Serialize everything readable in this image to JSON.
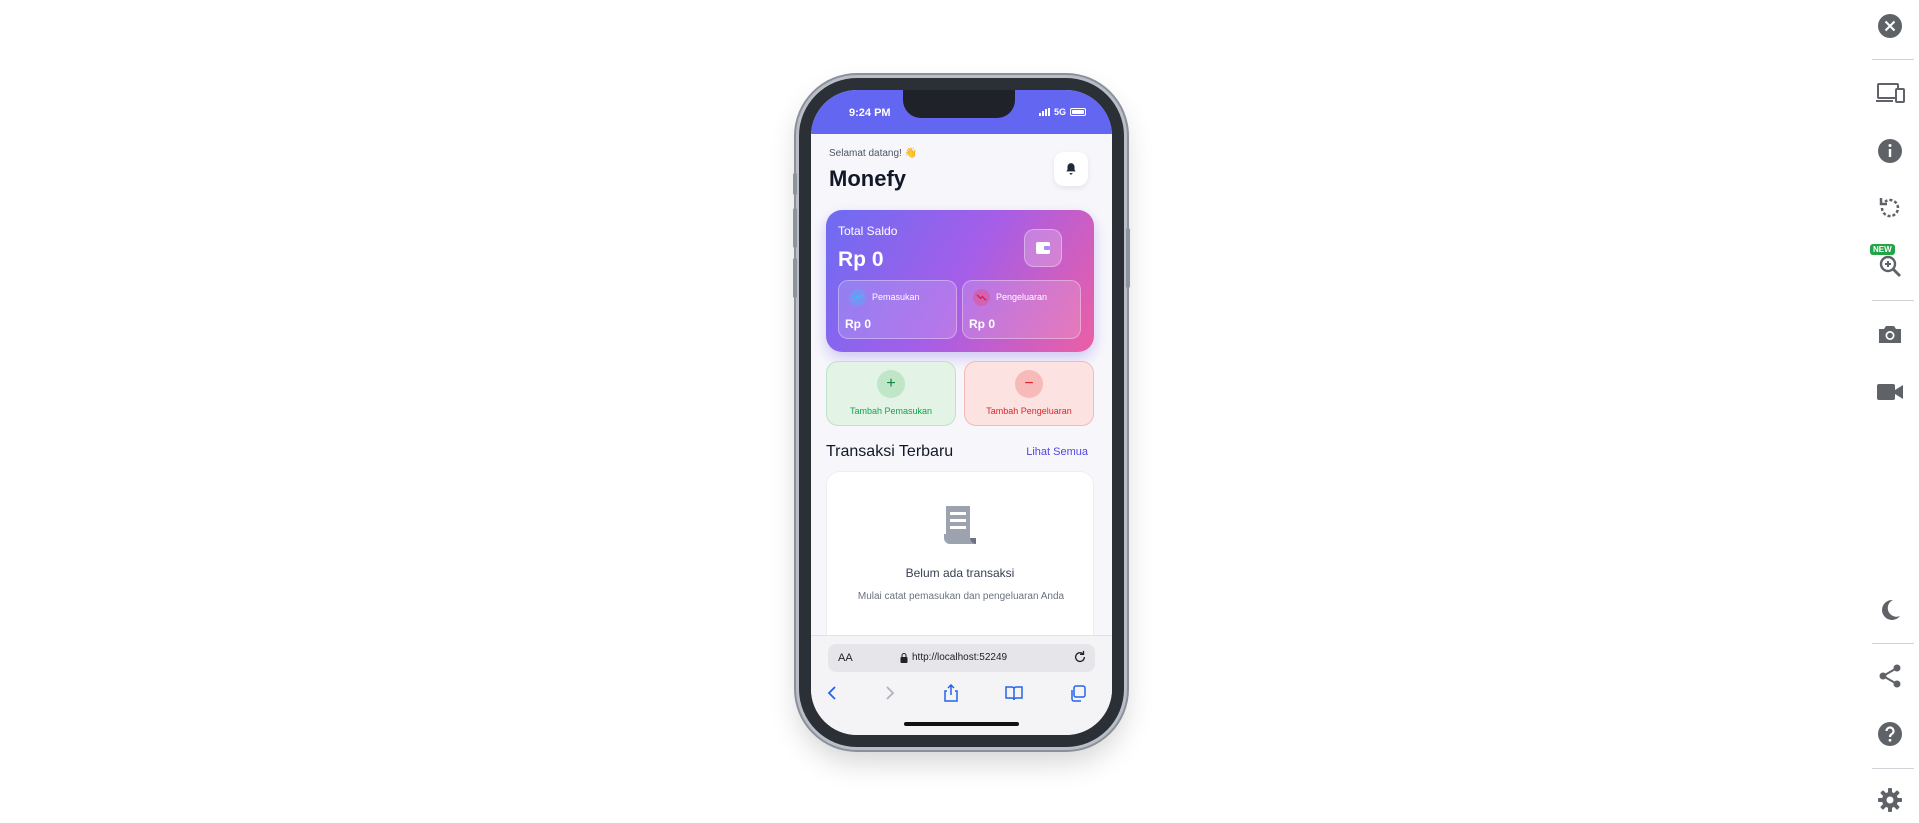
{
  "status_bar": {
    "time": "9:24 PM",
    "network": "5G"
  },
  "header": {
    "greeting": "Selamat datang! 👋",
    "app_name": "Monefy"
  },
  "balance": {
    "label": "Total Saldo",
    "value": "Rp 0",
    "income": {
      "label": "Pemasukan",
      "value": "Rp 0"
    },
    "expense": {
      "label": "Pengeluaran",
      "value": "Rp 0"
    }
  },
  "actions": {
    "add_income": {
      "icon": "+",
      "label": "Tambah Pemasukan"
    },
    "add_expense": {
      "icon": "−",
      "label": "Tambah Pengeluaran"
    }
  },
  "transactions": {
    "title": "Transaksi Terbaru",
    "see_all": "Lihat Semua",
    "empty_title": "Belum ada transaksi",
    "empty_subtitle": "Mulai catat pemasukan dan pengeluaran Anda"
  },
  "browser": {
    "text_size": "AA",
    "url": "http://localhost:52249"
  },
  "rail": {
    "new_badge": "NEW",
    "icons": [
      "close-icon",
      "devices-icon",
      "info-icon",
      "rotate-icon",
      "zoom-icon",
      "camera-icon",
      "video-icon",
      "dark-mode-icon",
      "share-icon",
      "help-icon",
      "settings-icon"
    ]
  },
  "colors": {
    "primary": "#6366f1",
    "income": "#16a34a",
    "expense": "#dc2626"
  }
}
